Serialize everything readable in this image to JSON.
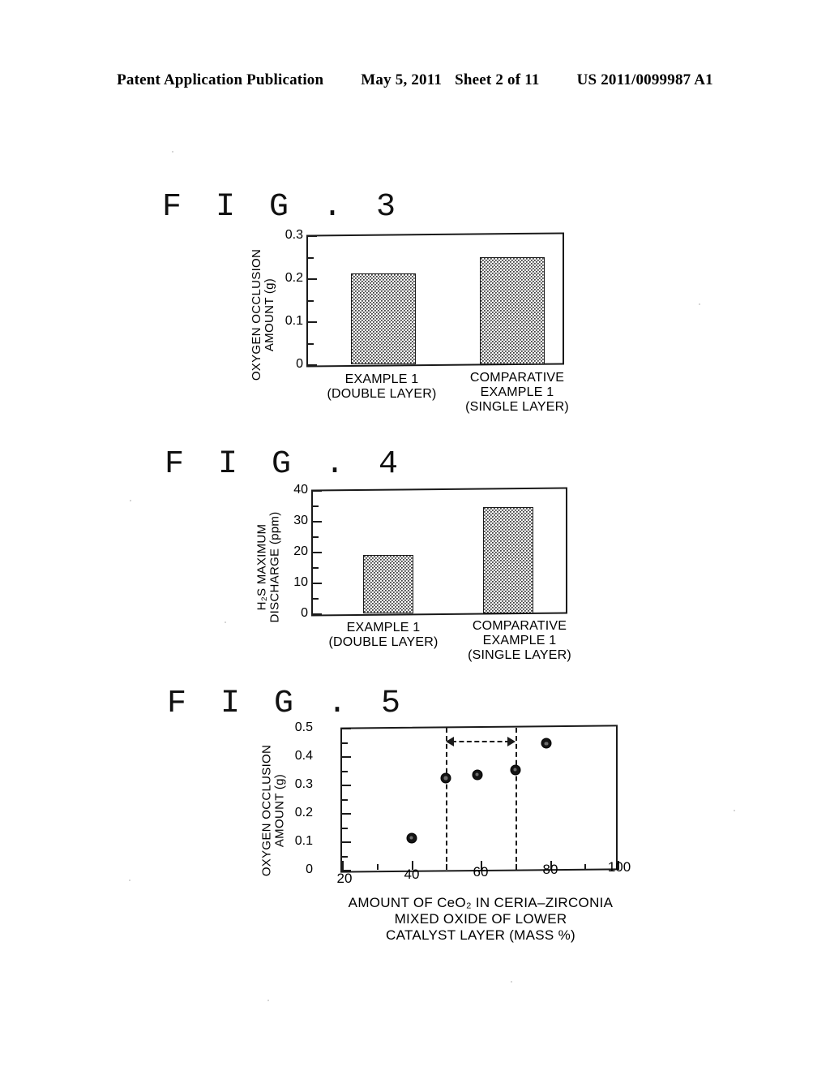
{
  "header": {
    "publication": "Patent Application Publication",
    "date": "May 5, 2011",
    "sheet": "Sheet 2 of 11",
    "publication_number": "US 2011/0099987 A1"
  },
  "figures": [
    {
      "label": "F I G . 3",
      "chart_data": {
        "type": "bar",
        "title": "FIG. 3",
        "categories": [
          "EXAMPLE 1\n(DOUBLE LAYER)",
          "COMPARATIVE\nEXAMPLE 1\n(SINGLE LAYER)"
        ],
        "category_lines": [
          [
            "EXAMPLE 1",
            "(DOUBLE LAYER)"
          ],
          [
            "COMPARATIVE",
            "EXAMPLE 1",
            "(SINGLE LAYER)"
          ]
        ],
        "values": [
          0.212,
          0.25
        ],
        "ylabel": "OXYGEN OCCLUSION AMOUNT (g)",
        "ylabel_lines": [
          "OXYGEN OCCLUSION",
          "AMOUNT (g)"
        ],
        "xlabel": "",
        "ylim": [
          0,
          0.3
        ],
        "yticks": [
          "0",
          "0.1",
          "0.2",
          "0.3"
        ],
        "ytick_values": [
          0,
          0.1,
          0.2,
          0.3
        ],
        "yminor_values": [
          0.05,
          0.15,
          0.25
        ],
        "grid": false,
        "legend": "none"
      }
    },
    {
      "label": "F I G . 4",
      "chart_data": {
        "type": "bar",
        "title": "FIG. 4",
        "categories": [
          "EXAMPLE 1\n(DOUBLE LAYER)",
          "COMPARATIVE\nEXAMPLE 1\n(SINGLE LAYER)"
        ],
        "category_lines": [
          [
            "EXAMPLE 1",
            "(DOUBLE LAYER)"
          ],
          [
            "COMPARATIVE",
            "EXAMPLE 1",
            "(SINGLE LAYER)"
          ]
        ],
        "values": [
          19,
          34.5
        ],
        "ylabel": "H2S MAXIMUM DISCHARGE (ppm)",
        "ylabel_lines": [
          "H₂S MAXIMUM",
          "DISCHARGE (ppm)"
        ],
        "xlabel": "",
        "ylim": [
          0,
          40
        ],
        "yticks": [
          "0",
          "10",
          "20",
          "30",
          "40"
        ],
        "ytick_values": [
          0,
          10,
          20,
          30,
          40
        ],
        "yminor_values": [
          5,
          15,
          25,
          35
        ],
        "grid": false,
        "legend": "none"
      }
    },
    {
      "label": "F I G . 5",
      "chart_data": {
        "type": "scatter",
        "title": "FIG. 5",
        "x": [
          40,
          50,
          59,
          70,
          79
        ],
        "y": [
          0.11,
          0.315,
          0.327,
          0.345,
          0.435
        ],
        "ylabel": "OXYGEN OCCLUSION AMOUNT (g)",
        "ylabel_lines": [
          "OXYGEN OCCLUSION",
          "AMOUNT (g)"
        ],
        "xlabel": "AMOUNT OF CeO2 IN CERIA-ZIRCONIA MIXED OXIDE OF LOWER CATALYST LAYER (MASS %)",
        "xlabel_lines": [
          "AMOUNT OF CeO₂ IN CERIA–ZIRCONIA",
          "MIXED OXIDE OF LOWER",
          "CATALYST LAYER (MASS %)"
        ],
        "xlim": [
          20,
          100
        ],
        "ylim": [
          0,
          0.5
        ],
        "xticks": [
          "20",
          "40",
          "60",
          "80",
          "100"
        ],
        "xtick_values": [
          20,
          40,
          60,
          80,
          100
        ],
        "xminor_values": [
          30,
          50,
          70,
          90
        ],
        "yticks": [
          "0",
          "0.1",
          "0.2",
          "0.3",
          "0.4",
          "0.5"
        ],
        "ytick_values": [
          0,
          0.1,
          0.2,
          0.3,
          0.4,
          0.5
        ],
        "yminor_values": [
          0.05,
          0.15,
          0.25,
          0.35,
          0.45
        ],
        "annotations": {
          "range_markers": [
            50,
            70
          ],
          "range_arrow": {
            "from": 50,
            "to": 70,
            "y": 0.455,
            "style": "double-headed-dashed"
          }
        },
        "grid": false,
        "legend": "none"
      }
    }
  ],
  "colors": {
    "ink": "#1a1a1a",
    "paper": "#ffffff",
    "bar_fill": "#fdfdfd",
    "dot": "#141414"
  }
}
